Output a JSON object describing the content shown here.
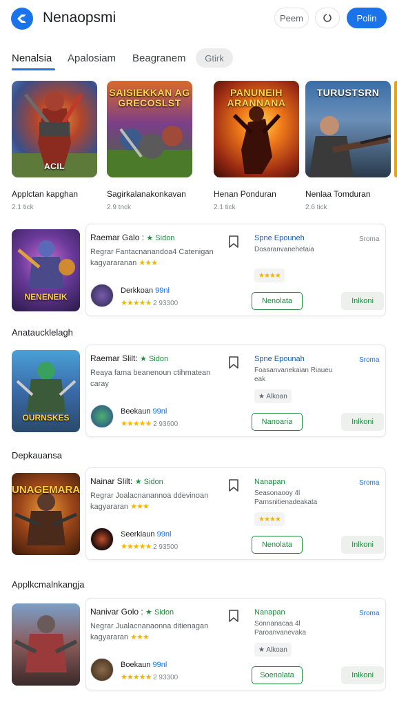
{
  "header": {
    "title": "Nenaopsmi",
    "btn_outline": "Peem",
    "btn_primary": "Polin"
  },
  "tabs": [
    {
      "label": "Nenalsia"
    },
    {
      "label": "Apalosiam"
    },
    {
      "label": "Beagranem"
    },
    {
      "label": "Gtirk"
    }
  ],
  "featured": [
    {
      "title": "Applctan kapghan",
      "sub": "2.1 tick",
      "overlay": "ACIL"
    },
    {
      "title": "Sagirkalanakonkavan",
      "sub": "2.9 tnck",
      "overlay": "SAISIEKKAN AG GRECOSLST"
    },
    {
      "title": "Henan Ponduran",
      "sub": "2.1 tick",
      "overlay": "PANUNEIH ARANNANA"
    },
    {
      "title": "Nenlaa Tomduran",
      "sub": "2.6 tick",
      "overlay": "TURUSTSRN"
    }
  ],
  "sections": [
    {
      "label": ""
    },
    {
      "label": "Anataucklelagh"
    },
    {
      "label": "Depkauansa"
    },
    {
      "label": "Applkcmalnkangja"
    }
  ],
  "apps": [
    {
      "thumb_overlay": "NENENEIK",
      "title": "Raemar Galo :",
      "tag": "★ Sidon",
      "desc": "Regrar Fantacnanandoa4 Catenigan kagyararanan",
      "desc_stars": "★★★",
      "dev_name": "Derkkoan",
      "dev_hi": "99nl",
      "dev_stars": "★★★★★",
      "dev_count": "2 93300",
      "right_title": "Spne Epouneh",
      "right_sub": "Dosaranvanehetaia",
      "right_chip": "★★★★",
      "right_label": "Sroma",
      "btn_primary": "Nenolata",
      "btn_secondary": "Inlkoni"
    },
    {
      "thumb_overlay": "OURNSKES",
      "title": "Raemar Slilt:",
      "tag": "★ Sidon",
      "desc": "Reaya fama beanenoun ctihmatean caray",
      "desc_stars": "",
      "dev_name": "Beekaun",
      "dev_hi": "99nl",
      "dev_stars": "★★★★★",
      "dev_count": "2 93600",
      "right_title": "Spne Epounah",
      "right_sub": "Foasanvanekaian Riaueu eak",
      "right_chip": "★ Alkoan",
      "right_label": "Sroma",
      "btn_primary": "Nanoaria",
      "btn_secondary": "Inlkoni"
    },
    {
      "thumb_overlay": "UNAGEMARA",
      "title": "Nainar Slilt:",
      "tag": "★ Sidon",
      "desc": "Regrar Joalacnanannoa ddevinoan kagyararan",
      "desc_stars": "★★★",
      "dev_name": "Seerkiaun",
      "dev_hi": "99nl",
      "dev_stars": "★★★★★",
      "dev_count": "2 93500",
      "right_title": "Nanapan",
      "right_sub": "Seasonaooy 4l Parnsnitienadeakata",
      "right_chip": "★★★★",
      "right_label": "Sroma",
      "btn_primary": "Nenolata",
      "btn_secondary": "Inlkoni"
    },
    {
      "thumb_overlay": "",
      "title": "Nanivar Golo :",
      "tag": "★ Sidon",
      "desc": "Negrar Jualacnanaonna ditienagan kagyararan",
      "desc_stars": "★★★",
      "dev_name": "Boekaun",
      "dev_hi": "99nl",
      "dev_stars": "★★★★★",
      "dev_count": "2 93300",
      "right_title": "Nanapan",
      "right_sub": "Sonnanacaa 4l Paroanvanevaka",
      "right_chip": "★ Alkoan",
      "right_label": "Sroma",
      "btn_primary": "Soenolata",
      "btn_secondary": "Inlkoni"
    }
  ],
  "colors": {
    "accent": "#1a73e8",
    "green": "#1e8e3e",
    "star": "#f4b400"
  }
}
